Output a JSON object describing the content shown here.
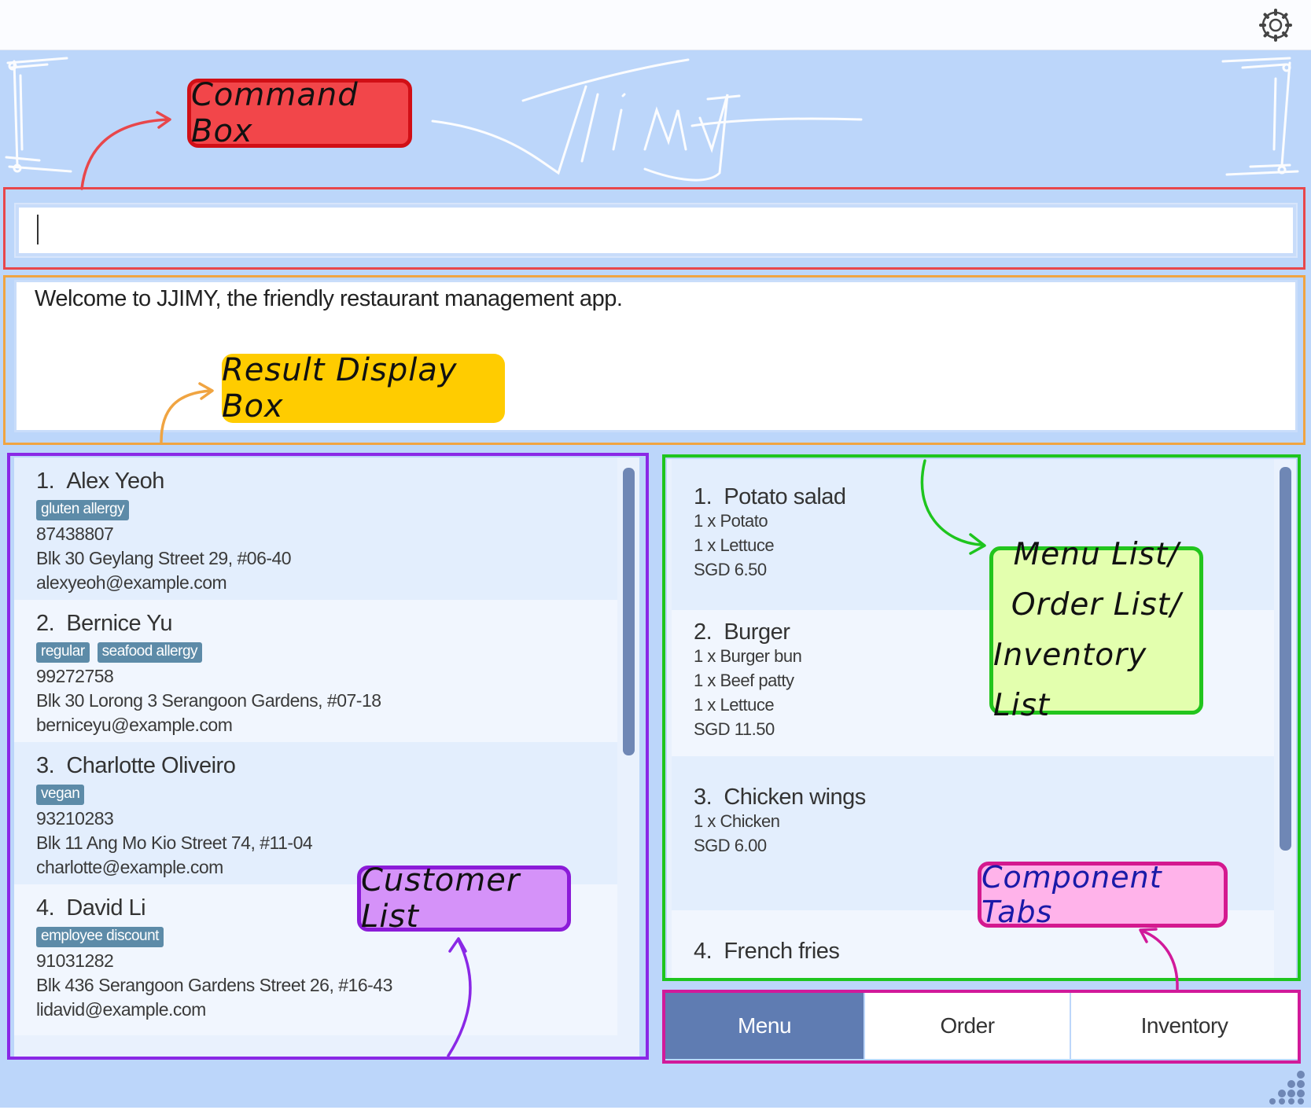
{
  "app": {
    "title": "JJimy",
    "settings_icon": "gear-icon",
    "resize_icon": "resize-grip-icon"
  },
  "command_box": {
    "value": "",
    "placeholder": ""
  },
  "result_display": {
    "text": "Welcome to JJIMY, the friendly restaurant management app."
  },
  "customers": [
    {
      "index": "1.",
      "name": "Alex Yeoh",
      "tags": [
        "gluten allergy"
      ],
      "phone": "87438807",
      "address": "Blk 30 Geylang Street 29, #06-40",
      "email": "alexyeoh@example.com"
    },
    {
      "index": "2.",
      "name": "Bernice Yu",
      "tags": [
        "regular",
        "seafood allergy"
      ],
      "phone": "99272758",
      "address": "Blk 30 Lorong 3 Serangoon Gardens, #07-18",
      "email": "berniceyu@example.com"
    },
    {
      "index": "3.",
      "name": "Charlotte Oliveiro",
      "tags": [
        "vegan"
      ],
      "phone": "93210283",
      "address": "Blk 11 Ang Mo Kio Street 74, #11-04",
      "email": "charlotte@example.com"
    },
    {
      "index": "4.",
      "name": "David Li",
      "tags": [
        "employee discount"
      ],
      "phone": "91031282",
      "address": "Blk 436 Serangoon Gardens Street 26, #16-43",
      "email": "lidavid@example.com"
    }
  ],
  "menu_items": [
    {
      "index": "1.",
      "name": "Potato salad",
      "ingredients": [
        "1 x Potato",
        "1 x Lettuce"
      ],
      "price": "SGD 6.50"
    },
    {
      "index": "2.",
      "name": "Burger",
      "ingredients": [
        "1 x Burger bun",
        "1 x Beef patty",
        "1 x Lettuce"
      ],
      "price": "SGD 11.50"
    },
    {
      "index": "3.",
      "name": "Chicken wings",
      "ingredients": [
        "1 x Chicken"
      ],
      "price": "SGD 6.00"
    },
    {
      "index": "4.",
      "name": "French fries",
      "ingredients": [],
      "price": ""
    }
  ],
  "tabs": [
    {
      "label": "Menu",
      "selected": true
    },
    {
      "label": "Order",
      "selected": false
    },
    {
      "label": "Inventory",
      "selected": false
    }
  ],
  "annotations": {
    "command_box": "Command Box",
    "result_display": "Result Display Box",
    "customer_list": "Customer List",
    "menu_list_lines": [
      "Menu List/",
      "Order List/",
      "Inventory List"
    ],
    "component_tabs": "Component Tabs"
  },
  "colors": {
    "app_background": "#bcd6fa",
    "tab_selected": "#5f7cb2",
    "tag": "#5d8ba8",
    "command_outline": "#e8474b",
    "result_outline": "#f0a441",
    "customer_outline": "#8a28e6",
    "menu_outline": "#1ec51e",
    "tabs_outline": "#d11a9a"
  }
}
